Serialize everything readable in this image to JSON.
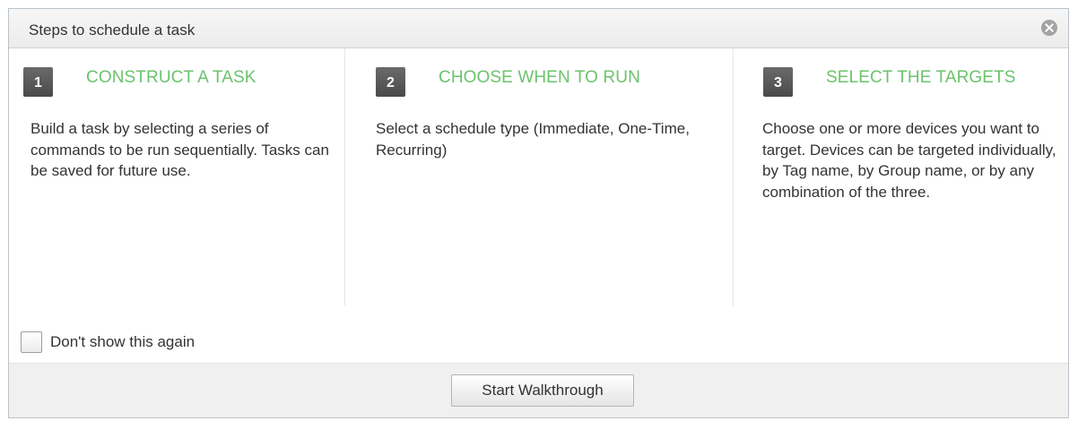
{
  "dialog": {
    "title": "Steps to schedule a task",
    "close_icon": "close-circle-icon"
  },
  "steps": [
    {
      "number": "1",
      "heading": "CONSTRUCT A TASK",
      "description": "Build a task by selecting a series of commands to be run sequentially. Tasks can be saved for future use."
    },
    {
      "number": "2",
      "heading": "CHOOSE WHEN TO RUN",
      "description": "Select a schedule type (Immediate, One-Time, Recurring)"
    },
    {
      "number": "3",
      "heading": "SELECT THE TARGETS",
      "description": "Choose one or more devices you want to target. Devices can be targeted individually, by Tag name, by Group name, or by any combination of the three."
    }
  ],
  "dont_show": {
    "label": "Don't show this again",
    "checked": false
  },
  "footer": {
    "start_button_label": "Start Walkthrough"
  },
  "colors": {
    "heading_green": "#6bc36b",
    "step_badge": "#555555"
  }
}
